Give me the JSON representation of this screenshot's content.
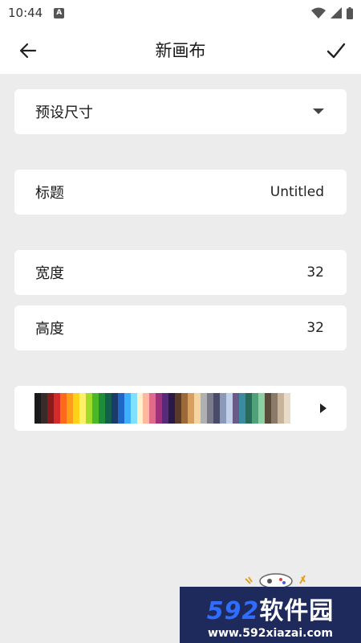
{
  "status_bar": {
    "time": "10:44",
    "notification_icon": "A"
  },
  "app_bar": {
    "title": "新画布",
    "back_icon": "arrow-left-icon",
    "confirm_icon": "check-icon"
  },
  "preset": {
    "label": "预设尺寸",
    "icon": "dropdown-icon"
  },
  "title_field": {
    "label": "标题",
    "value": "Untitled"
  },
  "width_field": {
    "label": "宽度",
    "value": "32"
  },
  "height_field": {
    "label": "高度",
    "value": "32"
  },
  "palette": {
    "colors": [
      "#1a1a1a",
      "#3a2b2b",
      "#8b1a1a",
      "#d42a2a",
      "#ff6a1a",
      "#ff9c1a",
      "#ffd21a",
      "#fff06a",
      "#9edb2a",
      "#4ab82a",
      "#1f8c3a",
      "#14604a",
      "#1a3a6a",
      "#1e66c8",
      "#3fb0ff",
      "#7fe0ff",
      "#fff2c8",
      "#ffb8a0",
      "#e06a8a",
      "#a0307a",
      "#5a2a7a",
      "#2a1a4a",
      "#5a3a2a",
      "#9a6a3a",
      "#d8a060",
      "#f4d4a0",
      "#b0b0b0",
      "#7a7a8a",
      "#4a4a6a",
      "#8a9ab8",
      "#c0d0e8",
      "#6a5a8a",
      "#3a8aa0",
      "#2a6a5a",
      "#50a07a",
      "#8ad0a0",
      "#5a4a3a",
      "#8a7a6a",
      "#c8b49a",
      "#e8dcc8"
    ],
    "icon": "play-arrow-icon"
  },
  "watermark": {
    "brand_num": "592",
    "brand_text": "软件园",
    "url": "www.592xiazai.com"
  }
}
